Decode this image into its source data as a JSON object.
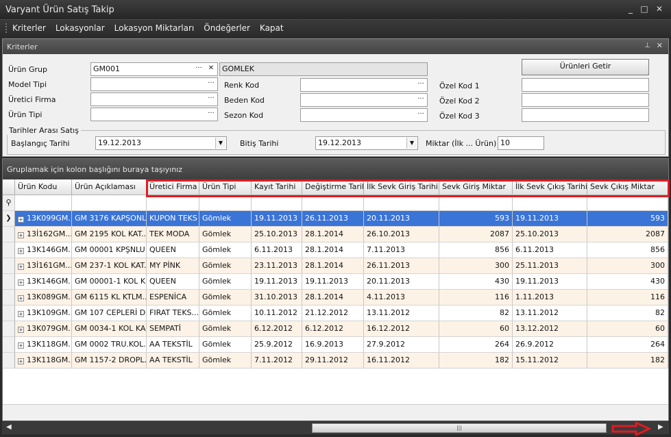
{
  "window": {
    "title": "Varyant Ürün Satış Takip",
    "minimize": "_",
    "maximize": "□",
    "close": "✕"
  },
  "menu": [
    "Kriterler",
    "Lokasyonlar",
    "Lokasyon Miktarları",
    "Öndeğerler",
    "Kapat"
  ],
  "panel": {
    "title": "Kriterler",
    "pin": "⊥",
    "close": "✕"
  },
  "criteria": {
    "urun_grup_label": "Ürün Grup",
    "urun_grup_value": "GM001",
    "urun_grup_desc": "GOMLEK",
    "model_tipi_label": "Model Tipi",
    "uretici_firma_label": "Üretici Firma",
    "urun_tipi_label": "Ürün Tipi",
    "renk_kod_label": "Renk Kod",
    "beden_kod_label": "Beden Kod",
    "sezon_kod_label": "Sezon Kod",
    "ozel_kod_1_label": "Özel Kod 1",
    "ozel_kod_2_label": "Özel Kod 2",
    "ozel_kod_3_label": "Özel Kod 3",
    "getir_button": "Ürünleri Getir",
    "ellipsis": "···",
    "clear": "✕"
  },
  "dates": {
    "group_label": "Tarihler Arası Satış",
    "start_label": "Başlangıç Tarihi",
    "start_value": "19.12.2013",
    "end_label": "Bitiş Tarihi",
    "end_value": "19.12.2013",
    "qty_label": "Miktar (İlk ... Ürün)",
    "qty_value": "10",
    "dropdown": "▼"
  },
  "grid": {
    "group_hint": "Gruplamak için kolon başlığını buraya taşıyınız",
    "filter_icon": "⚲",
    "columns": [
      "Ürün Kodu",
      "Ürün Açıklaması",
      "Üretici Firma",
      "Ürün Tipi",
      "Kayıt Tarihi",
      "Değiştirme Tarihi",
      "İlk Sevk Giriş Tarihi",
      "Sevk Giriş Miktar",
      "İlk Sevk Çıkış Tarihi",
      "Sevk Çıkış Miktar"
    ],
    "rows": [
      [
        "13K099GM...",
        "GM 3176 KAPŞONL...",
        "KUPON TEKS",
        "Gömlek",
        "19.11.2013",
        "26.11.2013",
        "20.11.2013",
        "593",
        "19.11.2013",
        "593"
      ],
      [
        "13İ162GM...",
        "GM 2195 KOL KAT...",
        "TEK MODA",
        "Gömlek",
        "25.10.2013",
        "28.1.2014",
        "26.10.2013",
        "2087",
        "25.10.2013",
        "2087"
      ],
      [
        "13K146GM...",
        "GM 00001 KPŞNLU...",
        "QUEEN",
        "Gömlek",
        "6.11.2013",
        "28.1.2014",
        "7.11.2013",
        "856",
        "6.11.2013",
        "856"
      ],
      [
        "13İ161GM...",
        "GM 237-1 KOL KAT...",
        "MY PİNK",
        "Gömlek",
        "23.11.2013",
        "28.1.2014",
        "26.11.2013",
        "300",
        "25.11.2013",
        "300"
      ],
      [
        "13K146GM...",
        "GM 00001-1 KOL K...",
        "QUEEN",
        "Gömlek",
        "19.11.2013",
        "19.11.2013",
        "20.11.2013",
        "430",
        "19.11.2013",
        "430"
      ],
      [
        "13K089GM...",
        "GM 6115 KL KTLM...",
        "ESPENİCA",
        "Gömlek",
        "31.10.2013",
        "28.1.2014",
        "4.11.2013",
        "116",
        "1.11.2013",
        "116"
      ],
      [
        "13K109GM...",
        "GM 107 CEPLERİ D...",
        "FIRAT TEKS...",
        "Gömlek",
        "10.11.2012",
        "21.12.2012",
        "13.11.2012",
        "82",
        "13.11.2012",
        "82"
      ],
      [
        "13K079GM...",
        "GM 0034-1 KOL KA...",
        "SEMPATİ",
        "Gömlek",
        "6.12.2012",
        "6.12.2012",
        "16.12.2012",
        "60",
        "13.12.2012",
        "60"
      ],
      [
        "13K118GM...",
        "GM 0002 TRU.KOL...",
        "AA TEKSTİL",
        "Gömlek",
        "25.9.2012",
        "16.9.2013",
        "27.9.2012",
        "264",
        "26.9.2012",
        "264"
      ],
      [
        "13K118GM...",
        "GM 1157-2 DROPL...",
        "AA TEKSTİL",
        "Gömlek",
        "7.11.2012",
        "29.11.2012",
        "16.11.2012",
        "182",
        "15.11.2012",
        "182"
      ]
    ]
  },
  "scroll": {
    "left": "◀",
    "right": "▶",
    "thumb": "|||"
  },
  "colors": {
    "selected_row": "#3a74d6",
    "alt_row": "#fdf2e6",
    "highlight": "#e01b22"
  }
}
